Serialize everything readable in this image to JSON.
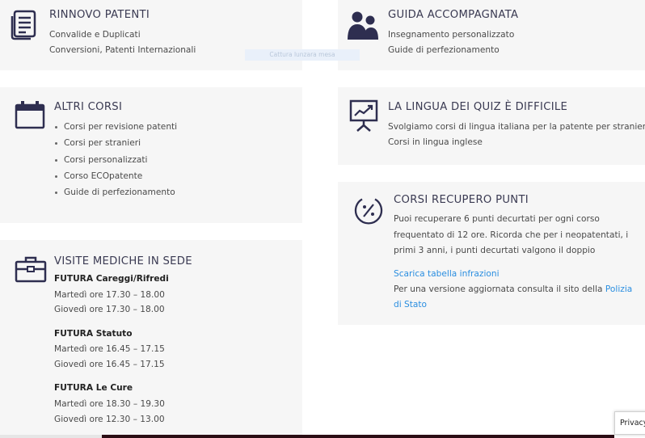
{
  "rinnovo": {
    "title": "RINNOVO PATENTI",
    "lines": [
      "Convalide e Duplicati",
      "Conversioni, Patenti Internazionali"
    ],
    "icon": "document-icon"
  },
  "guida": {
    "title": "GUIDA ACCOMPAGNATA",
    "lines": [
      "Insegnamento personalizzato",
      "Guide di perfezionamento"
    ],
    "icon": "users-icon"
  },
  "overlay_text": "Cattura lunzara mesa",
  "altri": {
    "title": "ALTRI CORSI",
    "items": [
      "Corsi per revisione patenti",
      "Corsi per stranieri",
      "Corsi personalizzati",
      "Corso ECOpatente",
      "Guide di perfezionamento"
    ],
    "icon": "calendar-icon"
  },
  "lingua": {
    "title": "LA LINGUA DEI QUIZ È DIFFICILE",
    "lines": [
      "Svolgiamo corsi di lingua italiana per la patente per stranieri",
      "Corsi in lingua inglese"
    ],
    "icon": "presentation-chart-icon"
  },
  "recupero": {
    "title": "CORSI RECUPERO PUNTI",
    "lines": [
      "Puoi recuperare 6 punti decurtati per ogni corso",
      "frequentato di 12 ore. Ricorda che per i neopatentati, i",
      "primi 3 anni, i punti decurtati valgono il doppio"
    ],
    "link_tabella": "Scarica tabella infrazioni",
    "versione_prefix": "Per una versione aggiornata consulta il sito della",
    "polizia_link_1": "Polizia",
    "polizia_link_2": "di Stato",
    "icon": "percent-circle-icon"
  },
  "visite": {
    "title": "VISITE MEDICHE IN SEDE",
    "icon": "briefcase-icon",
    "sedi": [
      {
        "name": "FUTURA Careggi/Rifredi",
        "lines": [
          "Martedì ore 17.30 – 18.00",
          "Giovedì ore 17.30 – 18.00"
        ]
      },
      {
        "name": "FUTURA Statuto",
        "lines": [
          "Martedì ore 16.45 – 17.15",
          "Giovedì ore 16.45 – 17.15"
        ]
      },
      {
        "name": "FUTURA Le Cure",
        "lines": [
          "Martedì ore 18.30 – 19.30",
          "Giovedì ore 12.30 – 13.00"
        ]
      }
    ]
  },
  "privacy_label": "Privacy",
  "colors": {
    "card_bg": "#f6f6f6",
    "icon": "#2e2e50",
    "link": "#2a8ee0",
    "footer": "#2b0d14"
  }
}
